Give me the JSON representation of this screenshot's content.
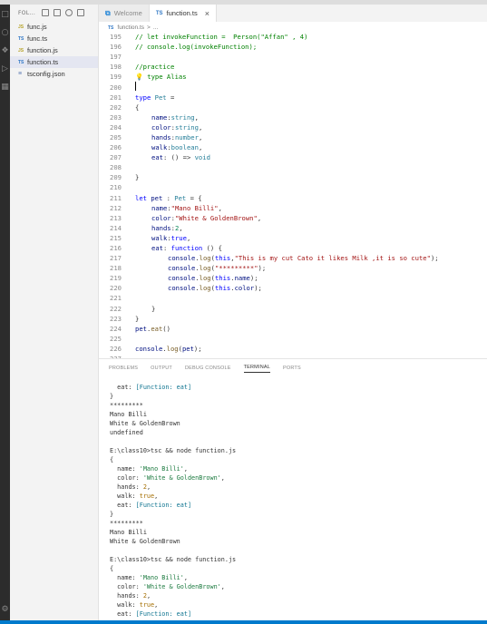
{
  "explorer": {
    "header": "FOL...",
    "files": [
      {
        "name": "func.js",
        "type": "js",
        "icon": "JS",
        "active": false
      },
      {
        "name": "func.ts",
        "type": "ts",
        "icon": "TS",
        "active": false
      },
      {
        "name": "function.js",
        "type": "js",
        "icon": "JS",
        "active": false
      },
      {
        "name": "function.ts",
        "type": "ts",
        "icon": "TS",
        "active": true
      },
      {
        "name": "tsconfig.json",
        "type": "json",
        "icon": "≡",
        "active": false
      }
    ]
  },
  "tabs": [
    {
      "label": "Welcome",
      "icon": "vscode-icon",
      "active": false
    },
    {
      "label": "function.ts",
      "icon": "TS",
      "active": true,
      "close": "×"
    }
  ],
  "breadcrumb": {
    "icon": "TS",
    "file": "function.ts",
    "sep": ">",
    "rest": "..."
  },
  "editor": {
    "lines": [
      {
        "n": "195",
        "indent": 0,
        "tokens": [
          [
            "// let invokeFunction =  Person(\"Affan\" , 4)",
            "comment"
          ]
        ]
      },
      {
        "n": "196",
        "indent": 0,
        "tokens": [
          [
            "// console.log(invokeFunction);",
            "comment"
          ]
        ]
      },
      {
        "n": "197",
        "indent": 0,
        "tokens": []
      },
      {
        "n": "198",
        "indent": 0,
        "tokens": [
          [
            "//practice",
            "comment"
          ]
        ]
      },
      {
        "n": "199",
        "indent": 0,
        "tokens": [
          [
            "💡 ",
            "plain"
          ],
          [
            "type Alias",
            "comment"
          ]
        ]
      },
      {
        "n": "200",
        "indent": 0,
        "tokens": [],
        "cursor": true
      },
      {
        "n": "201",
        "indent": 0,
        "tokens": [
          [
            "type ",
            "kw"
          ],
          [
            "Pet",
            "type"
          ],
          [
            " =",
            "punc"
          ]
        ]
      },
      {
        "n": "202",
        "indent": 0,
        "tokens": [
          [
            "{",
            "punc"
          ]
        ]
      },
      {
        "n": "203",
        "indent": 1,
        "tokens": [
          [
            "name",
            "prop"
          ],
          [
            ":",
            "punc"
          ],
          [
            "string",
            "type"
          ],
          [
            ",",
            "punc"
          ]
        ]
      },
      {
        "n": "204",
        "indent": 1,
        "tokens": [
          [
            "color",
            "prop"
          ],
          [
            ":",
            "punc"
          ],
          [
            "string",
            "type"
          ],
          [
            ",",
            "punc"
          ]
        ]
      },
      {
        "n": "205",
        "indent": 1,
        "tokens": [
          [
            "hands",
            "prop"
          ],
          [
            ":",
            "punc"
          ],
          [
            "number",
            "type"
          ],
          [
            ",",
            "punc"
          ]
        ]
      },
      {
        "n": "206",
        "indent": 1,
        "tokens": [
          [
            "walk",
            "prop"
          ],
          [
            ":",
            "punc"
          ],
          [
            "boolean",
            "type"
          ],
          [
            ",",
            "punc"
          ]
        ]
      },
      {
        "n": "207",
        "indent": 1,
        "tokens": [
          [
            "eat",
            "prop"
          ],
          [
            ": () => ",
            "punc"
          ],
          [
            "void",
            "type"
          ]
        ]
      },
      {
        "n": "208",
        "indent": 0,
        "tokens": []
      },
      {
        "n": "209",
        "indent": 0,
        "tokens": [
          [
            "}",
            "punc"
          ]
        ]
      },
      {
        "n": "210",
        "indent": 0,
        "tokens": []
      },
      {
        "n": "211",
        "indent": 0,
        "tokens": [
          [
            "let ",
            "kw"
          ],
          [
            "pet",
            "prop"
          ],
          [
            " : ",
            "punc"
          ],
          [
            "Pet",
            "type"
          ],
          [
            " = {",
            "punc"
          ]
        ]
      },
      {
        "n": "212",
        "indent": 1,
        "tokens": [
          [
            "name",
            "prop"
          ],
          [
            ":",
            "punc"
          ],
          [
            "\"Mano Billi\"",
            "str"
          ],
          [
            ",",
            "punc"
          ]
        ]
      },
      {
        "n": "213",
        "indent": 1,
        "tokens": [
          [
            "color",
            "prop"
          ],
          [
            ":",
            "punc"
          ],
          [
            "\"White & GoldenBrown\"",
            "str"
          ],
          [
            ",",
            "punc"
          ]
        ]
      },
      {
        "n": "214",
        "indent": 1,
        "tokens": [
          [
            "hands",
            "prop"
          ],
          [
            ":",
            "punc"
          ],
          [
            "2",
            "num"
          ],
          [
            ",",
            "punc"
          ]
        ]
      },
      {
        "n": "215",
        "indent": 1,
        "tokens": [
          [
            "walk",
            "prop"
          ],
          [
            ":",
            "punc"
          ],
          [
            "true",
            "kw"
          ],
          [
            ",",
            "punc"
          ]
        ]
      },
      {
        "n": "216",
        "indent": 1,
        "tokens": [
          [
            "eat",
            "prop"
          ],
          [
            ": ",
            "punc"
          ],
          [
            "function",
            "kw"
          ],
          [
            " () {",
            "punc"
          ]
        ]
      },
      {
        "n": "217",
        "indent": 2,
        "tokens": [
          [
            "console",
            "prop"
          ],
          [
            ".",
            "punc"
          ],
          [
            "log",
            "fn"
          ],
          [
            "(",
            "punc"
          ],
          [
            "this",
            "kw"
          ],
          [
            ",",
            "punc"
          ],
          [
            "\"This is my cut Cato it likes Milk ,it is so cute\"",
            "str"
          ],
          [
            ");",
            "punc"
          ]
        ]
      },
      {
        "n": "218",
        "indent": 2,
        "tokens": [
          [
            "console",
            "prop"
          ],
          [
            ".",
            "punc"
          ],
          [
            "log",
            "fn"
          ],
          [
            "(",
            "punc"
          ],
          [
            "\"*********\"",
            "str"
          ],
          [
            ");",
            "punc"
          ]
        ]
      },
      {
        "n": "219",
        "indent": 2,
        "tokens": [
          [
            "console",
            "prop"
          ],
          [
            ".",
            "punc"
          ],
          [
            "log",
            "fn"
          ],
          [
            "(",
            "punc"
          ],
          [
            "this",
            "kw"
          ],
          [
            ".",
            "punc"
          ],
          [
            "name",
            "prop"
          ],
          [
            ");",
            "punc"
          ]
        ]
      },
      {
        "n": "220",
        "indent": 2,
        "tokens": [
          [
            "console",
            "prop"
          ],
          [
            ".",
            "punc"
          ],
          [
            "log",
            "fn"
          ],
          [
            "(",
            "punc"
          ],
          [
            "this",
            "kw"
          ],
          [
            ".",
            "punc"
          ],
          [
            "color",
            "prop"
          ],
          [
            ");",
            "punc"
          ]
        ]
      },
      {
        "n": "221",
        "indent": 0,
        "tokens": []
      },
      {
        "n": "222",
        "indent": 1,
        "tokens": [
          [
            "}",
            "punc"
          ]
        ]
      },
      {
        "n": "223",
        "indent": 0,
        "tokens": [
          [
            "}",
            "punc"
          ]
        ]
      },
      {
        "n": "224",
        "indent": 0,
        "tokens": [
          [
            "pet",
            "prop"
          ],
          [
            ".",
            "punc"
          ],
          [
            "eat",
            "fn"
          ],
          [
            "()",
            "punc"
          ]
        ]
      },
      {
        "n": "225",
        "indent": 0,
        "tokens": []
      },
      {
        "n": "226",
        "indent": 0,
        "tokens": [
          [
            "console",
            "prop"
          ],
          [
            ".",
            "punc"
          ],
          [
            "log",
            "fn"
          ],
          [
            "(",
            "punc"
          ],
          [
            "pet",
            "prop"
          ],
          [
            ");",
            "punc"
          ]
        ]
      },
      {
        "n": "227",
        "indent": 0,
        "tokens": []
      }
    ]
  },
  "panel": {
    "tabs": [
      {
        "label": "PROBLEMS",
        "active": false
      },
      {
        "label": "OUTPUT",
        "active": false
      },
      {
        "label": "DEBUG CONSOLE",
        "active": false
      },
      {
        "label": "TERMINAL",
        "active": true
      },
      {
        "label": "PORTS",
        "active": false
      }
    ]
  },
  "terminal": {
    "lines": [
      [
        [
          "  eat: ",
          "plain"
        ],
        [
          "[Function: eat]",
          "fn"
        ]
      ],
      [
        [
          "}",
          "plain"
        ]
      ],
      [
        [
          "*********",
          "plain"
        ]
      ],
      [
        [
          "Mano Billi",
          "plain"
        ]
      ],
      [
        [
          "White & GoldenBrown",
          "plain"
        ]
      ],
      [
        [
          "undefined",
          "plain"
        ]
      ],
      [
        [
          "",
          "plain"
        ]
      ],
      [
        [
          "E:\\class10>tsc && node function.js",
          "plain"
        ]
      ],
      [
        [
          "{",
          "plain"
        ]
      ],
      [
        [
          "  name: ",
          "plain"
        ],
        [
          "'Mano Billi'",
          "str"
        ],
        [
          ",",
          "plain"
        ]
      ],
      [
        [
          "  color: ",
          "plain"
        ],
        [
          "'White & GoldenBrown'",
          "str"
        ],
        [
          ",",
          "plain"
        ]
      ],
      [
        [
          "  hands: ",
          "plain"
        ],
        [
          "2",
          "num"
        ],
        [
          ",",
          "plain"
        ]
      ],
      [
        [
          "  walk: ",
          "plain"
        ],
        [
          "true",
          "num"
        ],
        [
          ",",
          "plain"
        ]
      ],
      [
        [
          "  eat: ",
          "plain"
        ],
        [
          "[Function: eat]",
          "fn"
        ]
      ],
      [
        [
          "}",
          "plain"
        ]
      ],
      [
        [
          "*********",
          "plain"
        ]
      ],
      [
        [
          "Mano Billi",
          "plain"
        ]
      ],
      [
        [
          "White & GoldenBrown",
          "plain"
        ]
      ],
      [
        [
          "",
          "plain"
        ]
      ],
      [
        [
          "E:\\class10>tsc && node function.js",
          "plain"
        ]
      ],
      [
        [
          "{",
          "plain"
        ]
      ],
      [
        [
          "  name: ",
          "plain"
        ],
        [
          "'Mano Billi'",
          "str"
        ],
        [
          ",",
          "plain"
        ]
      ],
      [
        [
          "  color: ",
          "plain"
        ],
        [
          "'White & GoldenBrown'",
          "str"
        ],
        [
          ",",
          "plain"
        ]
      ],
      [
        [
          "  hands: ",
          "plain"
        ],
        [
          "2",
          "num"
        ],
        [
          ",",
          "plain"
        ]
      ],
      [
        [
          "  walk: ",
          "plain"
        ],
        [
          "true",
          "num"
        ],
        [
          ",",
          "plain"
        ]
      ],
      [
        [
          "  eat: ",
          "plain"
        ],
        [
          "[Function: eat]",
          "fn"
        ]
      ]
    ]
  },
  "colors": {
    "activity_bar": "#2c2c2c",
    "status_bar": "#007acc",
    "ts_icon": "#3178c6",
    "js_icon": "#b7a42c",
    "comment": "#008000",
    "keyword": "#0000ff",
    "string": "#a31515"
  }
}
